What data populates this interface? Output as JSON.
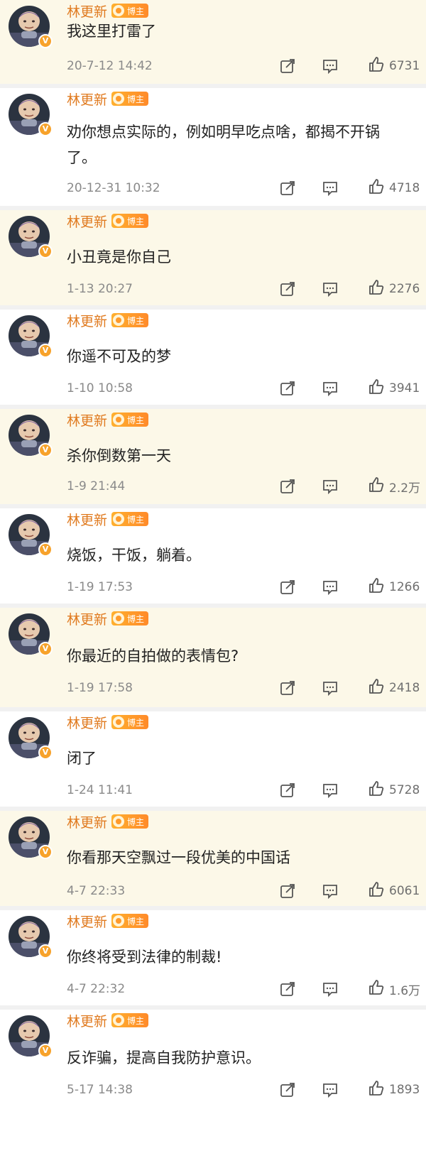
{
  "author": {
    "name": "林更新",
    "tag": "博主",
    "verified_mark": "V"
  },
  "icons": {
    "avatar": "avatar-buzz-lightyear",
    "share": "share-icon",
    "comment": "comment-icon",
    "like": "thumbs-up-icon"
  },
  "colors": {
    "name": "#e07a1f",
    "tag_bg": "#ff9a2a",
    "tint_bg": "#fcf8e8",
    "text": "#222222",
    "meta": "#8a8a8a"
  },
  "comments": [
    {
      "text": "我这里打雷了",
      "time": "20-7-12 14:42",
      "likes": "6731"
    },
    {
      "text": "劝你想点实际的，例如明早吃点啥，都揭不开锅了。",
      "time": "20-12-31 10:32",
      "likes": "4718"
    },
    {
      "text": "小丑竟是你自己",
      "time": "1-13 20:27",
      "likes": "2276"
    },
    {
      "text": "你遥不可及的梦",
      "time": "1-10 10:58",
      "likes": "3941"
    },
    {
      "text": "杀你倒数第一天",
      "time": "1-9 21:44",
      "likes": "2.2万"
    },
    {
      "text": "烧饭，干饭，躺着。",
      "time": "1-19 17:53",
      "likes": "1266"
    },
    {
      "text": "你最近的自拍做的表情包?",
      "time": "1-19 17:58",
      "likes": "2418"
    },
    {
      "text": "闭了",
      "time": "1-24 11:41",
      "likes": "5728"
    },
    {
      "text": "你看那天空飘过一段优美的中国话",
      "time": "4-7 22:33",
      "likes": "6061"
    },
    {
      "text": "你终将受到法律的制裁!",
      "time": "4-7 22:32",
      "likes": "1.6万"
    },
    {
      "text": "反诈骗，提高自我防护意识。",
      "time": "5-17 14:38",
      "likes": "1893"
    }
  ]
}
